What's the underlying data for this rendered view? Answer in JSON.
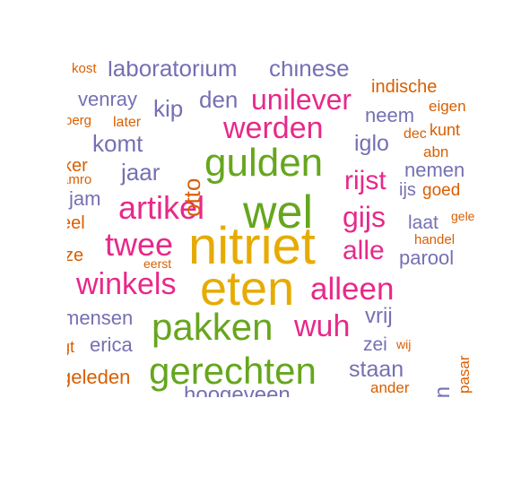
{
  "palette": {
    "orange": "#d95f02",
    "purple": "#7570b3",
    "pink": "#e7298a",
    "green": "#66a61e",
    "gold": "#e6ab02"
  },
  "words": [
    {
      "text": "nitriet",
      "color": "gold"
    },
    {
      "text": "eten",
      "color": "gold"
    },
    {
      "text": "wel",
      "color": "green"
    },
    {
      "text": "gulden",
      "color": "green"
    },
    {
      "text": "pakken",
      "color": "green"
    },
    {
      "text": "gerechten",
      "color": "green"
    },
    {
      "text": "twee",
      "color": "pink"
    },
    {
      "text": "artikel",
      "color": "pink"
    },
    {
      "text": "werden",
      "color": "pink"
    },
    {
      "text": "unilever",
      "color": "pink"
    },
    {
      "text": "alleen",
      "color": "pink"
    },
    {
      "text": "winkels",
      "color": "pink"
    },
    {
      "text": "wuh",
      "color": "pink"
    },
    {
      "text": "rijst",
      "color": "pink"
    },
    {
      "text": "gijs",
      "color": "pink"
    },
    {
      "text": "alle",
      "color": "pink"
    },
    {
      "text": "otto",
      "color": "orange"
    },
    {
      "text": "laboratorium",
      "color": "purple"
    },
    {
      "text": "chinese",
      "color": "purple"
    },
    {
      "text": "venray",
      "color": "purple"
    },
    {
      "text": "kip",
      "color": "purple"
    },
    {
      "text": "den",
      "color": "purple"
    },
    {
      "text": "komt",
      "color": "purple"
    },
    {
      "text": "jaar",
      "color": "purple"
    },
    {
      "text": "iglo",
      "color": "purple"
    },
    {
      "text": "neem",
      "color": "purple"
    },
    {
      "text": "nemen",
      "color": "purple"
    },
    {
      "text": "laat",
      "color": "purple"
    },
    {
      "text": "parool",
      "color": "purple"
    },
    {
      "text": "ijs",
      "color": "purple"
    },
    {
      "text": "vrij",
      "color": "purple"
    },
    {
      "text": "zei",
      "color": "purple"
    },
    {
      "text": "staan",
      "color": "purple"
    },
    {
      "text": "genomen",
      "color": "purple"
    },
    {
      "text": "erica",
      "color": "purple"
    },
    {
      "text": "mensen",
      "color": "purple"
    },
    {
      "text": "jam",
      "color": "purple"
    },
    {
      "text": "hoogeveen",
      "color": "purple"
    },
    {
      "text": "indische",
      "color": "orange"
    },
    {
      "text": "eigen",
      "color": "orange"
    },
    {
      "text": "dec",
      "color": "orange"
    },
    {
      "text": "kunt",
      "color": "orange"
    },
    {
      "text": "abn",
      "color": "orange"
    },
    {
      "text": "goed",
      "color": "orange"
    },
    {
      "text": "gele",
      "color": "orange"
    },
    {
      "text": "handel",
      "color": "orange"
    },
    {
      "text": "wij",
      "color": "orange"
    },
    {
      "text": "pasar",
      "color": "orange"
    },
    {
      "text": "ander",
      "color": "orange"
    },
    {
      "text": "later",
      "color": "orange"
    },
    {
      "text": "eerst",
      "color": "orange"
    },
    {
      "text": "kost",
      "color": "orange"
    },
    {
      "text": "berg",
      "color": "orange"
    },
    {
      "text": "ker",
      "color": "orange"
    },
    {
      "text": "amro",
      "color": "orange"
    },
    {
      "text": "eel",
      "color": "orange"
    },
    {
      "text": "ze",
      "color": "orange"
    },
    {
      "text": "gt",
      "color": "orange"
    },
    {
      "text": "geleden",
      "color": "orange"
    }
  ]
}
